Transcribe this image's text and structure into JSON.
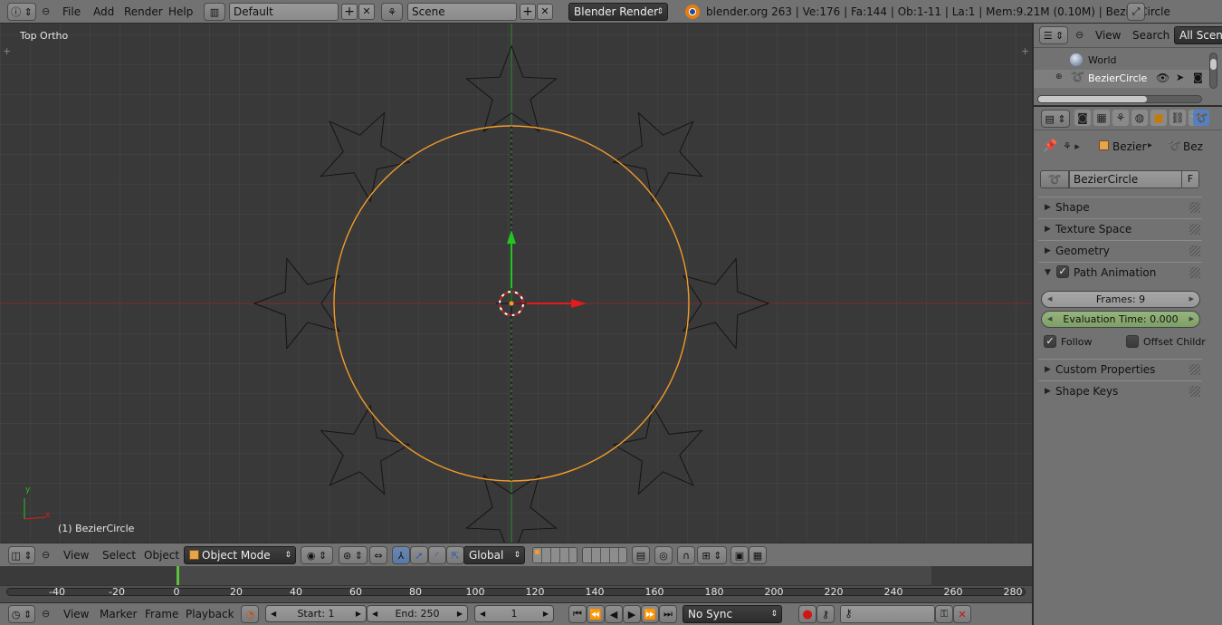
{
  "topbar": {
    "menus": [
      "File",
      "Add",
      "Render",
      "Help"
    ],
    "screen_layout": "Default",
    "scene": "Scene",
    "render_engine": "Blender Render",
    "stats": "blender.org 263 | Ve:176 | Fa:144 | Ob:1-11 | La:1 | Mem:9.21M (0.10M) | BezierCircle",
    "add_glyph": "+",
    "close_glyph": "✕"
  },
  "viewport": {
    "view_label": "Top Ortho",
    "object_label": "(1) BezierCircle",
    "axis_y": "y",
    "axis_x": "x"
  },
  "view3d_header": {
    "menus": [
      "View",
      "Select",
      "Object"
    ],
    "mode": "Object Mode",
    "orientation": "Global"
  },
  "timeline": {
    "ticks": [
      "-40",
      "-20",
      "0",
      "20",
      "40",
      "60",
      "80",
      "100",
      "120",
      "140",
      "160",
      "180",
      "200",
      "220",
      "240",
      "260",
      "280"
    ],
    "current_frame_marker": 0
  },
  "timeline_header": {
    "menus": [
      "View",
      "Marker",
      "Frame",
      "Playback"
    ],
    "start": "Start: 1",
    "end": "End: 250",
    "current": "1",
    "sync": "No Sync"
  },
  "outliner": {
    "menus": [
      "View",
      "Search"
    ],
    "filter": "All Scenes",
    "items": [
      "World",
      "BezierCircle"
    ]
  },
  "properties": {
    "breadcrumb": [
      "Bezier",
      "Bez"
    ],
    "data_name": "BezierCircle",
    "fake_user": "F",
    "panels": {
      "shape": "Shape",
      "texture_space": "Texture Space",
      "geometry": "Geometry",
      "path_animation": "Path Animation",
      "custom_properties": "Custom Properties",
      "shape_keys": "Shape Keys"
    },
    "frames": "Frames: 9",
    "evaluation_time": "Evaluation Time: 0.000",
    "follow": "Follow",
    "offset_children": "Offset Childr"
  },
  "colors": {
    "curve": "#f39b2a",
    "x_axis": "#e21b1b",
    "y_axis": "#22c422",
    "eval_field": "#8aa873",
    "active_tab": "#5680c2"
  }
}
